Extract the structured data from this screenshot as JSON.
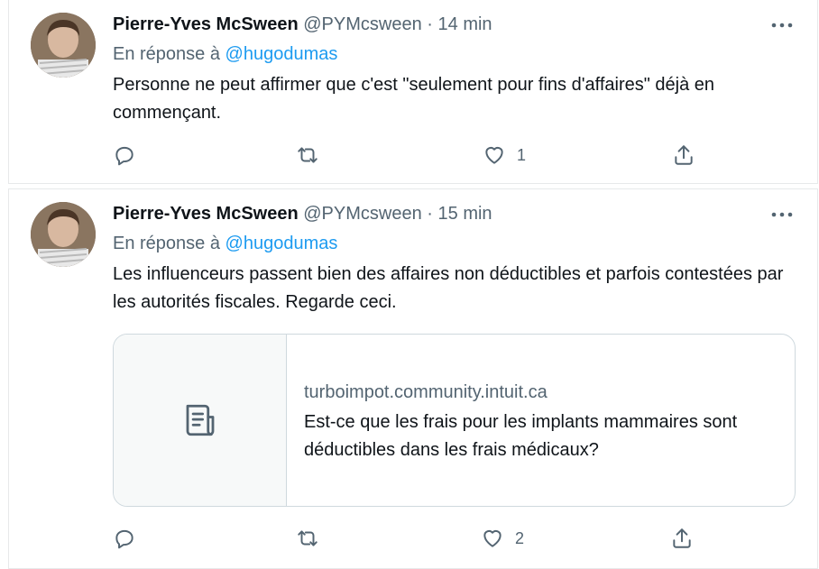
{
  "tweets": [
    {
      "author_name": "Pierre-Yves McSween",
      "handle": "@PYMcsween",
      "separator": "·",
      "time": "14 min",
      "reply_prefix": "En réponse à",
      "reply_mention": "@hugodumas",
      "text": "Personne ne peut affirmer que c'est \"seulement pour fins d'affaires\" déjà en commençant.",
      "likes": "1"
    },
    {
      "author_name": "Pierre-Yves McSween",
      "handle": "@PYMcsween",
      "separator": "·",
      "time": "15 min",
      "reply_prefix": "En réponse à",
      "reply_mention": "@hugodumas",
      "text": "Les influenceurs passent bien des affaires non déductibles et parfois contestées par les autorités fiscales. Regarde ceci.",
      "card": {
        "domain": "turboimpot.community.intuit.ca",
        "title": "Est-ce que les frais pour les implants mammaires sont déductibles dans les frais médicaux?",
        "icon": "article-icon"
      },
      "likes": "2"
    }
  ],
  "icons": {
    "reply": "reply-icon",
    "retweet": "retweet-icon",
    "like": "heart-icon",
    "share": "share-icon",
    "more": "more-icon"
  },
  "colors": {
    "accent": "#1d9bf0",
    "secondary_text": "#536471",
    "primary_text": "#0f1419",
    "border": "#cfd9de"
  }
}
